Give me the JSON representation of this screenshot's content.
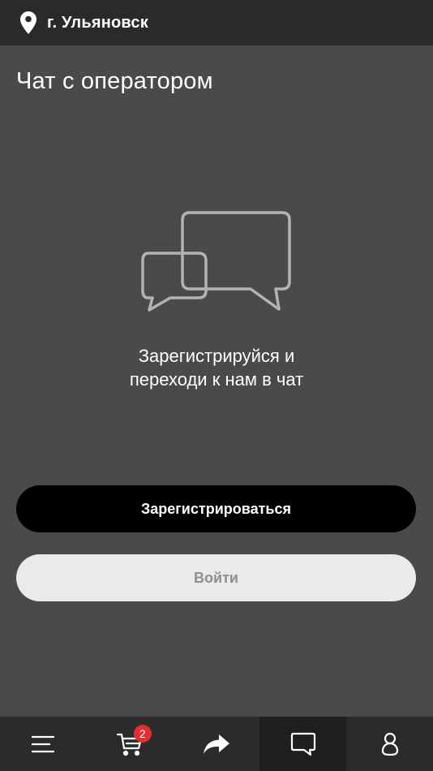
{
  "header": {
    "location_icon": "map-pin-icon",
    "city": "г. Ульяновск"
  },
  "main": {
    "title": "Чат с оператором",
    "illustration_icon": "chat-bubbles-icon",
    "message_line1": "Зарегистрируйся и",
    "message_line2": "переходи к нам в чат",
    "register_label": "Зарегистрироваться",
    "login_label": "Войти"
  },
  "tabbar": {
    "items": [
      {
        "icon": "menu-icon",
        "active": false
      },
      {
        "icon": "cart-icon",
        "active": false,
        "badge": "2"
      },
      {
        "icon": "share-icon",
        "active": false
      },
      {
        "icon": "chat-icon",
        "active": true
      },
      {
        "icon": "profile-icon",
        "active": false
      }
    ]
  },
  "colors": {
    "background": "#4a4a4a",
    "header": "#2a2a2a",
    "tabbar": "#2b2b2b",
    "tab_active": "#1f1f1f",
    "primary_button": "#000000",
    "secondary_button": "#ebe9ea",
    "badge": "#e62e2e"
  }
}
